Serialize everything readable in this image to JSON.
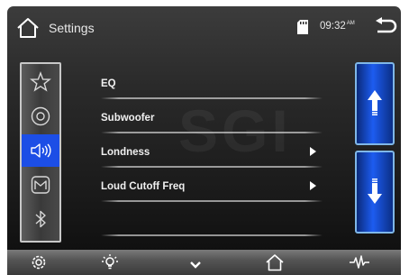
{
  "header": {
    "title": "Settings",
    "time": "09:32",
    "ampm": "AM"
  },
  "sidebar": {
    "items": [
      {
        "name": "favorites",
        "icon": "star-icon",
        "active": false
      },
      {
        "name": "disc",
        "icon": "disc-icon",
        "active": false
      },
      {
        "name": "audio",
        "icon": "speaker-icon",
        "active": true
      },
      {
        "name": "logo",
        "icon": "brand-logo-icon",
        "active": false
      },
      {
        "name": "bluetooth",
        "icon": "bluetooth-icon",
        "active": false
      }
    ]
  },
  "menu": {
    "items": [
      {
        "label": "EQ",
        "has_arrow": false
      },
      {
        "label": "Subwoofer",
        "has_arrow": false
      },
      {
        "label": "Londness",
        "has_arrow": true
      },
      {
        "label": "Loud Cutoff Freq",
        "has_arrow": true
      }
    ]
  },
  "bottom_bar": {
    "items": [
      "settings-gear-icon",
      "brightness-icon",
      "chevron-down-icon",
      "home-icon",
      "waveform-icon"
    ]
  },
  "colors": {
    "accent_blue": "#1c4ee6",
    "scroll_blue": "#1d5cf0"
  }
}
